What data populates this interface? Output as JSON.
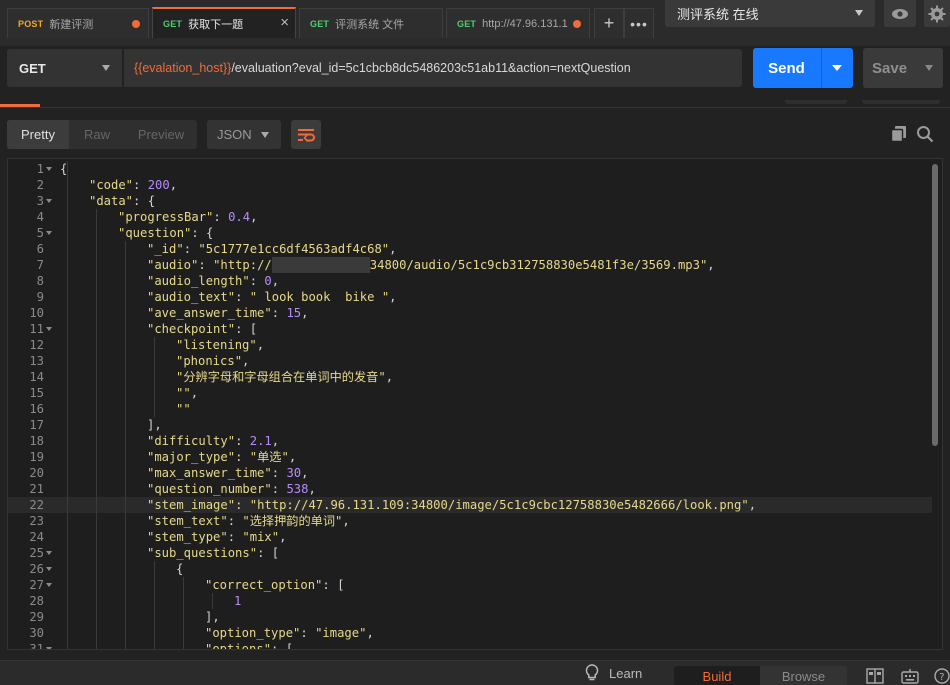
{
  "tabs": [
    {
      "method": "POST",
      "name": "新建评测",
      "dirty": true,
      "active": false
    },
    {
      "method": "GET",
      "name": "获取下一题",
      "dirty": false,
      "active": true
    },
    {
      "method": "GET",
      "name": "评测系统 文件",
      "dirty": false,
      "active": false
    },
    {
      "method": "GET",
      "name": "http://47.96.131.1",
      "dirty": true,
      "active": false
    }
  ],
  "environment": {
    "selected": "测评系统 在线"
  },
  "request": {
    "method": "GET",
    "url_variable": "{{evalation_host}}",
    "url_path": "/evaluation?eval_id=5c1cbcb8dc5486203c51ab11&action=nextQuestion",
    "send_label": "Send",
    "save_label": "Save"
  },
  "response_toolbar": {
    "view_tabs": [
      "Pretty",
      "Raw",
      "Preview"
    ],
    "active_view": "Pretty",
    "format": "JSON"
  },
  "code_lines": [
    {
      "n": "1",
      "fold": true,
      "indent": 0,
      "html": "<span class='p'>{</span>"
    },
    {
      "n": "2",
      "fold": false,
      "indent": 1,
      "html": "<span class='k'>\"code\"</span><span class='p'>: </span><span class='n'>200</span><span class='p'>,</span>"
    },
    {
      "n": "3",
      "fold": true,
      "indent": 1,
      "html": "<span class='k'>\"data\"</span><span class='p'>: {</span>"
    },
    {
      "n": "4",
      "fold": false,
      "indent": 2,
      "html": "<span class='k'>\"progressBar\"</span><span class='p'>: </span><span class='n'>0.4</span><span class='p'>,</span>"
    },
    {
      "n": "5",
      "fold": true,
      "indent": 2,
      "html": "<span class='k'>\"question\"</span><span class='p'>: {</span>"
    },
    {
      "n": "6",
      "fold": false,
      "indent": 3,
      "html": "<span class='k'>\"_id\"</span><span class='p'>: </span><span class='s'>\"5c1777e1cc6df4563adf4c68\"</span><span class='p'>,</span>"
    },
    {
      "n": "7",
      "fold": false,
      "indent": 3,
      "html": "<span class='k'>\"audio\"</span><span class='p'>: </span><span class='s'>\"http://</span><span class='redact' data-name='redacted-host' data-interactable='false'></span><span class='s'>34800/audio/5c1c9cb312758830e5481f3e/3569.mp3\"</span><span class='p'>,</span>"
    },
    {
      "n": "8",
      "fold": false,
      "indent": 3,
      "html": "<span class='k'>\"audio_length\"</span><span class='p'>: </span><span class='n'>0</span><span class='p'>,</span>"
    },
    {
      "n": "9",
      "fold": false,
      "indent": 3,
      "html": "<span class='k'>\"audio_text\"</span><span class='p'>: </span><span class='s'>\" look book  bike \"</span><span class='p'>,</span>"
    },
    {
      "n": "10",
      "fold": false,
      "indent": 3,
      "html": "<span class='k'>\"ave_answer_time\"</span><span class='p'>: </span><span class='n'>15</span><span class='p'>,</span>"
    },
    {
      "n": "11",
      "fold": true,
      "indent": 3,
      "html": "<span class='k'>\"checkpoint\"</span><span class='p'>: [</span>"
    },
    {
      "n": "12",
      "fold": false,
      "indent": 4,
      "html": "<span class='s'>\"listening\"</span><span class='p'>,</span>"
    },
    {
      "n": "13",
      "fold": false,
      "indent": 4,
      "html": "<span class='s'>\"phonics\"</span><span class='p'>,</span>"
    },
    {
      "n": "14",
      "fold": false,
      "indent": 4,
      "html": "<span class='s'>\"分辨字母和字母组合在单词中的发音\"</span><span class='p'>,</span>"
    },
    {
      "n": "15",
      "fold": false,
      "indent": 4,
      "html": "<span class='s'>\"\"</span><span class='p'>,</span>"
    },
    {
      "n": "16",
      "fold": false,
      "indent": 4,
      "html": "<span class='s'>\"\"</span>"
    },
    {
      "n": "17",
      "fold": false,
      "indent": 3,
      "html": "<span class='p'>],</span>"
    },
    {
      "n": "18",
      "fold": false,
      "indent": 3,
      "html": "<span class='k'>\"difficulty\"</span><span class='p'>: </span><span class='n'>2.1</span><span class='p'>,</span>"
    },
    {
      "n": "19",
      "fold": false,
      "indent": 3,
      "html": "<span class='k'>\"major_type\"</span><span class='p'>: </span><span class='s'>\"单选\"</span><span class='p'>,</span>"
    },
    {
      "n": "20",
      "fold": false,
      "indent": 3,
      "html": "<span class='k'>\"max_answer_time\"</span><span class='p'>: </span><span class='n'>30</span><span class='p'>,</span>"
    },
    {
      "n": "21",
      "fold": false,
      "indent": 3,
      "html": "<span class='k'>\"question_number\"</span><span class='p'>: </span><span class='n'>538</span><span class='p'>,</span>"
    },
    {
      "n": "22",
      "fold": false,
      "indent": 3,
      "highlight": true,
      "html": "<span class='k'>\"stem_image\"</span><span class='p'>: </span><span class='s'>\"http://47.96.131.109:34800/image/5c1c9cbc12758830e5482666/look.png\"</span><span class='p'>,</span>"
    },
    {
      "n": "23",
      "fold": false,
      "indent": 3,
      "html": "<span class='k'>\"stem_text\"</span><span class='p'>: </span><span class='s'>\"选择押韵的单词\"</span><span class='p'>,</span>"
    },
    {
      "n": "24",
      "fold": false,
      "indent": 3,
      "html": "<span class='k'>\"stem_type\"</span><span class='p'>: </span><span class='s'>\"mix\"</span><span class='p'>,</span>"
    },
    {
      "n": "25",
      "fold": true,
      "indent": 3,
      "html": "<span class='k'>\"sub_questions\"</span><span class='p'>: [</span>"
    },
    {
      "n": "26",
      "fold": true,
      "indent": 4,
      "html": "<span class='p'>{</span>"
    },
    {
      "n": "27",
      "fold": true,
      "indent": 5,
      "html": "<span class='k'>\"correct_option\"</span><span class='p'>: [</span>"
    },
    {
      "n": "28",
      "fold": false,
      "indent": 6,
      "html": "<span class='n'>1</span>"
    },
    {
      "n": "29",
      "fold": false,
      "indent": 5,
      "html": "<span class='p'>],</span>"
    },
    {
      "n": "30",
      "fold": false,
      "indent": 5,
      "html": "<span class='k'>\"option_type\"</span><span class='p'>: </span><span class='s'>\"image\"</span><span class='p'>,</span>"
    },
    {
      "n": "31",
      "fold": true,
      "indent": 5,
      "html": "<span class='k'>\"options\"</span><span class='p'>: [</span>"
    }
  ],
  "statusbar": {
    "learn_label": "Learn",
    "build_label": "Build",
    "browse_label": "Browse"
  },
  "colors": {
    "accent": "#f26b3a",
    "send_blue": "#1879ff",
    "get_green": "#4fcf6f",
    "post_orange": "#f5a623"
  }
}
